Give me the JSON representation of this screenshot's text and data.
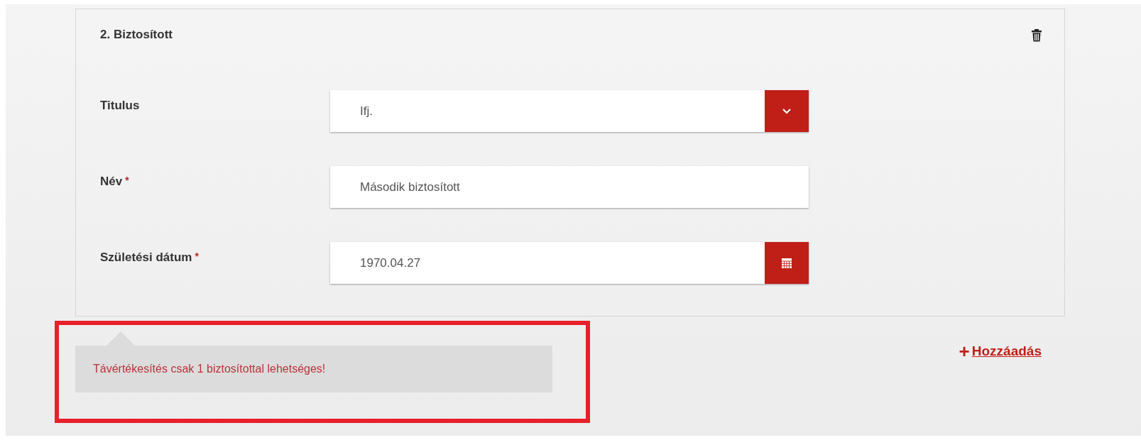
{
  "card": {
    "title": "2. Biztosított",
    "fields": [
      {
        "label": "Titulus",
        "kind": "select",
        "value": "Ifj."
      },
      {
        "label": "Név",
        "required_mark": "*",
        "kind": "text",
        "value": "Második biztosított"
      },
      {
        "label": "Születési dátum",
        "required_mark": "*",
        "kind": "date",
        "value": "1970.04.27"
      }
    ]
  },
  "message": {
    "text": "Távértékesítés csak 1 biztosítottal lehetséges!",
    "highlighted": true
  },
  "add_link": {
    "label": "Hozzáadás",
    "icon": "+"
  }
}
